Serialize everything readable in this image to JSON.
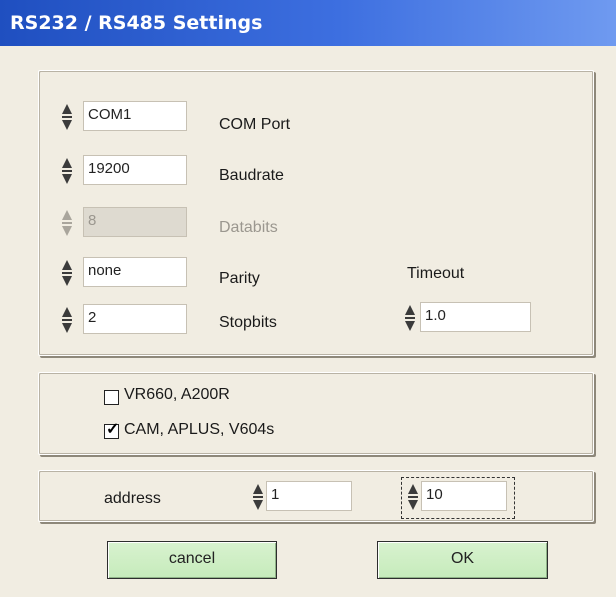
{
  "window": {
    "title": "RS232 / RS485 Settings"
  },
  "serial": {
    "com_port": {
      "value": "COM1",
      "label": "COM Port"
    },
    "baudrate": {
      "value": "19200",
      "label": "Baudrate"
    },
    "databits": {
      "value": "8",
      "label": "Databits",
      "enabled": false
    },
    "parity": {
      "value": "none",
      "label": "Parity"
    },
    "stopbits": {
      "value": "2",
      "label": "Stopbits"
    },
    "timeout": {
      "value": "1.0",
      "label": "Timeout"
    }
  },
  "devices": {
    "vr660": {
      "label": "VR660, A200R",
      "checked": false
    },
    "cam": {
      "label": "CAM, APLUS, V604s",
      "checked": true
    }
  },
  "address": {
    "label": "address",
    "value1": "1",
    "value2": "10"
  },
  "buttons": {
    "cancel": "cancel",
    "ok": "OK"
  },
  "icons": {
    "spinner": "spinner-arrows-icon",
    "check": "checkmark-icon"
  },
  "colors": {
    "title_bar": "#2f5fd0",
    "button_bg": "#ccefc1",
    "window_bg": "#f1ede2"
  }
}
